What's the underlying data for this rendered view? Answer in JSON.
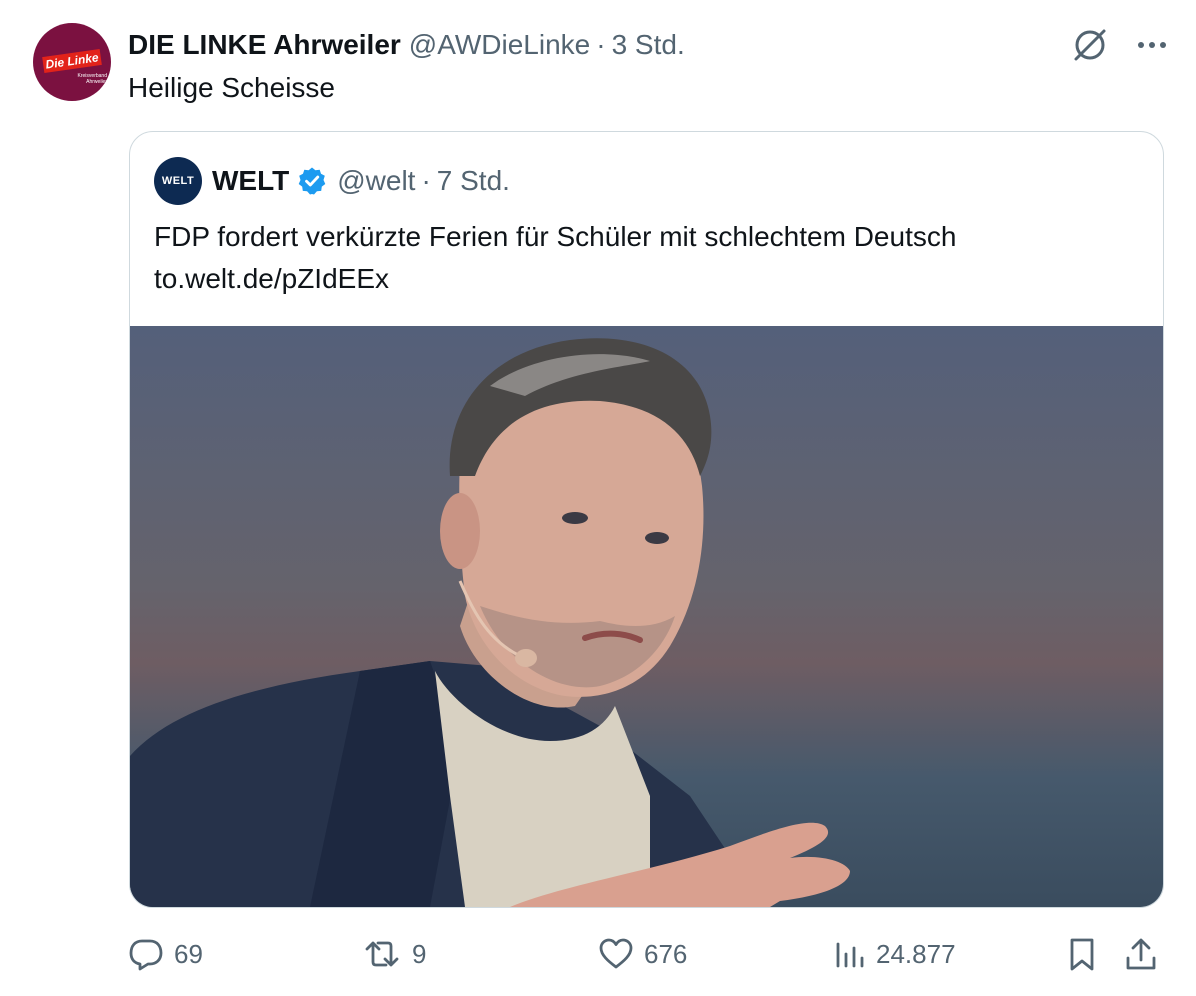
{
  "post": {
    "author_name": "DIE LINKE Ahrweiler",
    "handle": "@AWDieLinke",
    "separator": "·",
    "time": "3 Std.",
    "text": "Heilige Scheisse",
    "avatar": {
      "logo_text": "Die Linke",
      "sub_text": "Kreisverband Ahrweiler"
    }
  },
  "quoted": {
    "logo_text": "WELT",
    "author_name": "WELT",
    "handle": "@welt",
    "separator": "·",
    "time": "7 Std.",
    "text_line1": "FDP fordert verkürzte Ferien für Schüler mit schlechtem Deutsch",
    "text_line2": "to.welt.de/pZIdEEx"
  },
  "actions": {
    "replies": "69",
    "reposts": "9",
    "likes": "676",
    "views": "24.877"
  },
  "icons": {
    "top": [
      "grok-icon",
      "more-icon"
    ],
    "actions": [
      "reply-icon",
      "repost-icon",
      "like-icon",
      "views-icon",
      "bookmark-icon",
      "share-icon"
    ]
  },
  "colors": {
    "text": "#0f1419",
    "muted": "#536471",
    "border": "#cfd9de",
    "verified": "#1d9bf0",
    "avatar_bg": "#7b1140",
    "welt_bg": "#0d2a52"
  }
}
